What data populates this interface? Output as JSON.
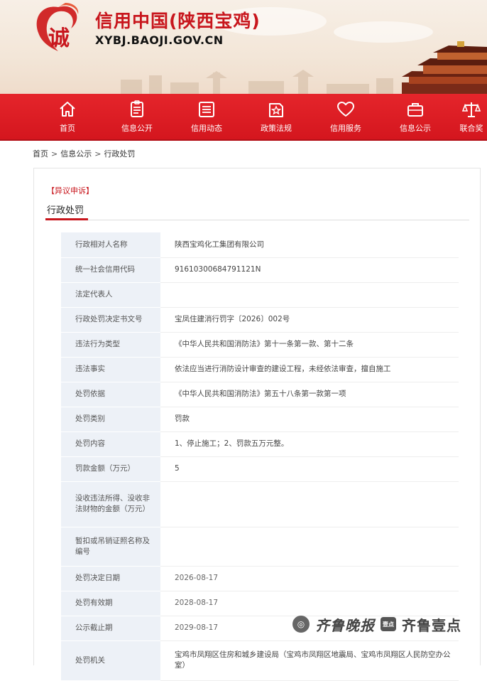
{
  "header": {
    "site_title": "信用中国(陕西宝鸡)",
    "site_domain": "XYBJ.BAOJI.GOV.CN",
    "brand_color": "#c8161d"
  },
  "nav": {
    "items": [
      {
        "label": "首页",
        "icon": "home-icon"
      },
      {
        "label": "信息公开",
        "icon": "document-icon"
      },
      {
        "label": "信用动态",
        "icon": "news-list-icon"
      },
      {
        "label": "政策法规",
        "icon": "policy-star-icon"
      },
      {
        "label": "信用服务",
        "icon": "heart-icon"
      },
      {
        "label": "信息公示",
        "icon": "briefcase-icon"
      },
      {
        "label": "联合奖",
        "icon": "scales-icon"
      }
    ]
  },
  "breadcrumb": {
    "items": [
      "首页",
      "信息公示",
      "行政处罚"
    ],
    "separator": ">"
  },
  "content": {
    "appeal_link": "【异议申诉】",
    "section_title": "行政处罚",
    "rows": [
      {
        "label": "行政相对人名称",
        "value": "陕西宝鸡化工集团有限公司"
      },
      {
        "label": "统一社会信用代码",
        "value": "91610300684791121N"
      },
      {
        "label": "法定代表人",
        "value": ""
      },
      {
        "label": "行政处罚决定书文号",
        "value": "宝凤住建消行罚字〔2026〕002号"
      },
      {
        "label": "违法行为类型",
        "value": "《中华人民共和国消防法》第十一条第一款、第十二条"
      },
      {
        "label": "违法事实",
        "value": "依法应当进行消防设计审查的建设工程，未经依法审查，擅自施工"
      },
      {
        "label": "处罚依据",
        "value": "《中华人民共和国消防法》第五十八条第一款第一项"
      },
      {
        "label": "处罚类别",
        "value": "罚款"
      },
      {
        "label": "处罚内容",
        "value": "1、停止施工；2、罚款五万元整。"
      },
      {
        "label": "罚款金额（万元）",
        "value": "5"
      },
      {
        "label": "没收违法所得、没收非法财物的金额（万元）",
        "value": ""
      },
      {
        "label": "暂扣或吊销证照名称及编号",
        "value": ""
      },
      {
        "label": "处罚决定日期",
        "value": "2026-08-17"
      },
      {
        "label": "处罚有效期",
        "value": "2028-08-17"
      },
      {
        "label": "公示截止期",
        "value": "2029-08-17"
      },
      {
        "label": "处罚机关",
        "value": "宝鸡市凤翔区住房和城乡建设局（宝鸡市凤翔区地震局、宝鸡市凤翔区人民防空办公室）"
      }
    ]
  },
  "watermark": {
    "left_text": "齐鲁晚报",
    "badge_text": "壹点",
    "right_text": "齐鲁壹点"
  }
}
